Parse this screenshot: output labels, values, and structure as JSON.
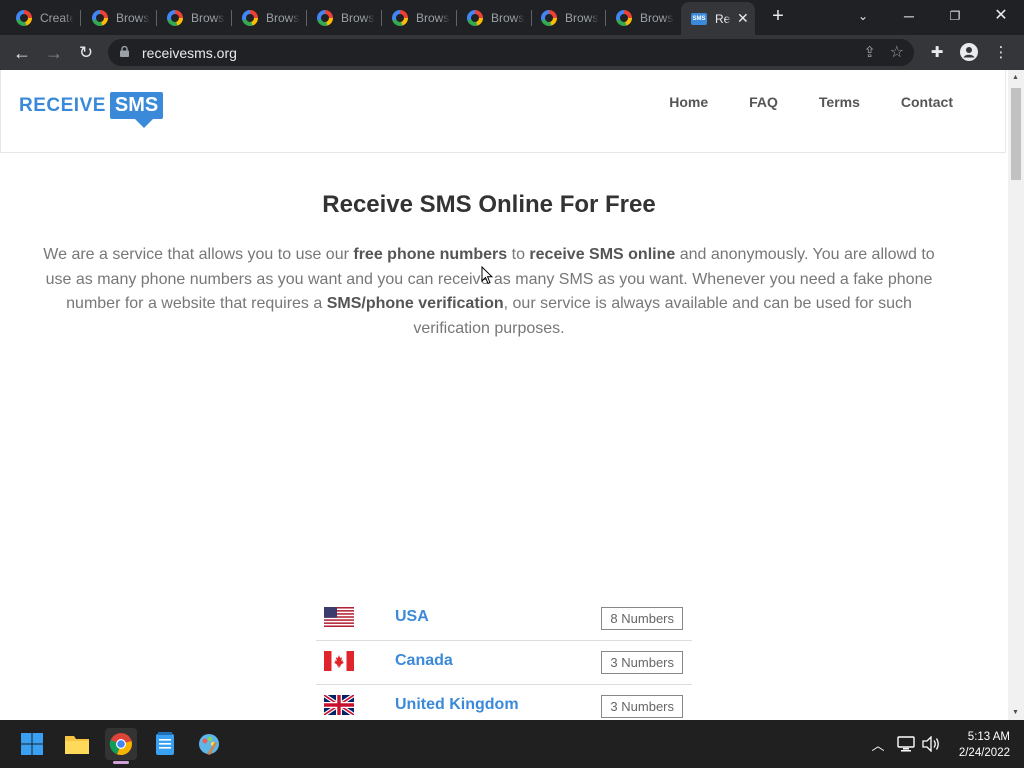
{
  "browser": {
    "tabs": [
      {
        "label": "Create"
      },
      {
        "label": "Browse"
      },
      {
        "label": "Browse"
      },
      {
        "label": "Browse"
      },
      {
        "label": "Browse"
      },
      {
        "label": "Browse"
      },
      {
        "label": "Browse"
      },
      {
        "label": "Browse"
      },
      {
        "label": "Browse"
      },
      {
        "label": "Receive SMS",
        "active": true
      }
    ],
    "new_tab_symbol": "+",
    "url": "receivesms.org"
  },
  "site": {
    "logo": {
      "part1": "RECEIVE",
      "part2": "SMS"
    },
    "nav": [
      "Home",
      "FAQ",
      "Terms",
      "Contact"
    ],
    "headline": "Receive SMS Online For Free",
    "intro": {
      "t1": "We are a service that allows you to use our ",
      "b1": "free phone numbers",
      "t2": " to ",
      "b2": "receive SMS online",
      "t3": " and anonymously. You are allowd to use as many phone numbers as you want and you can receive as many SMS as you want. Whenever you need a fake phone number for a website that requires a ",
      "b3": "SMS/phone verification",
      "t4": ", our service is always available and can be used for such verification purposes."
    },
    "countries": [
      {
        "name": "USA",
        "numbers": "8 Numbers",
        "flag": "us-flag-icon"
      },
      {
        "name": "Canada",
        "numbers": "3 Numbers",
        "flag": "canada-flag-icon"
      },
      {
        "name": "United Kingdom",
        "numbers": "3 Numbers",
        "flag": "uk-flag-icon"
      }
    ],
    "accent_color": "#3b8ad9"
  },
  "taskbar": {
    "time": "5:13 AM",
    "date": "2/24/2022"
  }
}
